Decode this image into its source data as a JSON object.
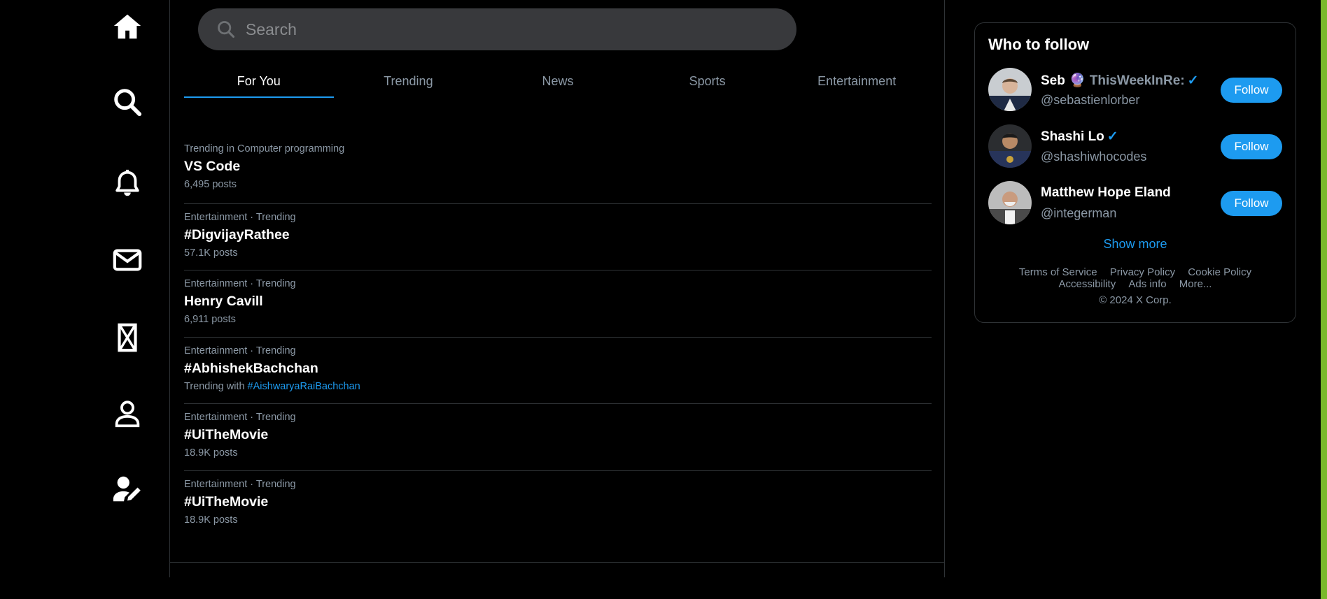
{
  "search": {
    "placeholder": "Search"
  },
  "tabs": [
    {
      "label": "For You"
    },
    {
      "label": "Trending"
    },
    {
      "label": "News"
    },
    {
      "label": "Sports"
    },
    {
      "label": "Entertainment"
    }
  ],
  "trends": [
    {
      "context": "Trending in Computer programming",
      "name": "VS Code",
      "meta": "6,495 posts"
    },
    {
      "context": "Entertainment · Trending",
      "name": "#DigvijayRathee",
      "meta": "57.1K posts"
    },
    {
      "context": "Entertainment · Trending",
      "name": "Henry Cavill",
      "meta": "6,911 posts"
    },
    {
      "context": "Entertainment · Trending",
      "name": "#AbhishekBachchan",
      "meta_prefix": "Trending with ",
      "meta_link": "#AishwaryaRaiBachchan"
    },
    {
      "context": "Entertainment · Trending",
      "name": "#UiTheMovie",
      "meta": "18.9K posts"
    },
    {
      "context": "Entertainment · Trending",
      "name": "#UiTheMovie",
      "meta": "18.9K posts"
    }
  ],
  "who_to_follow": {
    "title": "Who to follow",
    "people": [
      {
        "name": "Seb",
        "extra": "ThisWeekInRe:",
        "verified": "✓",
        "handle": "@sebastienlorber",
        "button": "Follow"
      },
      {
        "name": "Shashi Lo",
        "verified": "✓",
        "handle": "@shashiwhocodes",
        "button": "Follow"
      },
      {
        "name": "Matthew Hope Eland",
        "handle": "@integerman",
        "button": "Follow"
      }
    ],
    "show_more": "Show more",
    "footer": {
      "terms": "Terms of Service",
      "privacy": "Privacy Policy",
      "cookie": "Cookie Policy",
      "accessibility": "Accessibility",
      "ads": "Ads info",
      "more": "More...",
      "copyright": "© 2024 X Corp."
    }
  },
  "icons": {
    "nav": [
      "home-icon",
      "search-icon",
      "bell-icon",
      "mail-icon",
      "x-logo-icon",
      "user-icon",
      "user-edit-icon"
    ]
  },
  "colors": {
    "accent": "#1d9bf0",
    "background": "#000000",
    "muted": "#8b98a5",
    "edge": "#7ab82c"
  }
}
